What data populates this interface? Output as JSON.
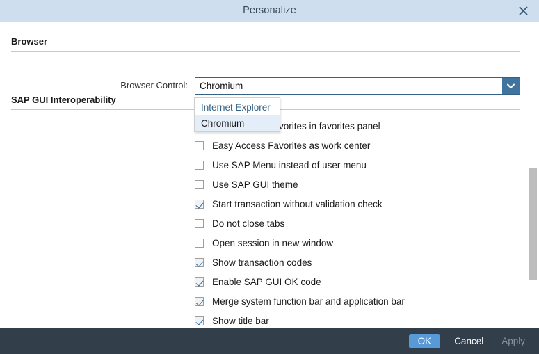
{
  "dialog": {
    "title": "Personalize",
    "close_icon": "close-icon",
    "title_bar_color": "#cfdeee",
    "footer_color": "#323e4a",
    "accent_color": "#5899d8"
  },
  "sections": {
    "browser": {
      "heading": "Browser",
      "browser_control": {
        "label": "Browser Control:",
        "value": "Chromium",
        "dropdown_icon": "chevron-down-icon",
        "options": [
          {
            "label": "Internet Explorer",
            "selected": false
          },
          {
            "label": "Chromium",
            "selected": true
          }
        ]
      }
    },
    "sap_gui_interoperability": {
      "heading": "SAP GUI Interoperability",
      "options": [
        {
          "label": "Easy Access Favorites in favorites panel",
          "checked": true
        },
        {
          "label": "Easy Access Favorites as work center",
          "checked": false
        },
        {
          "label": "Use SAP Menu instead of user menu",
          "checked": false
        },
        {
          "label": "Use SAP GUI theme",
          "checked": false
        },
        {
          "label": "Start transaction without validation check",
          "checked": true
        },
        {
          "label": "Do not close tabs",
          "checked": false
        },
        {
          "label": "Open session in new window",
          "checked": false
        },
        {
          "label": "Show transaction codes",
          "checked": true
        },
        {
          "label": "Enable SAP GUI OK code",
          "checked": true
        },
        {
          "label": "Merge system function bar and application bar",
          "checked": true
        },
        {
          "label": "Show title bar",
          "checked": true
        }
      ]
    }
  },
  "footer": {
    "ok_label": "OK",
    "cancel_label": "Cancel",
    "apply_label": "Apply"
  }
}
